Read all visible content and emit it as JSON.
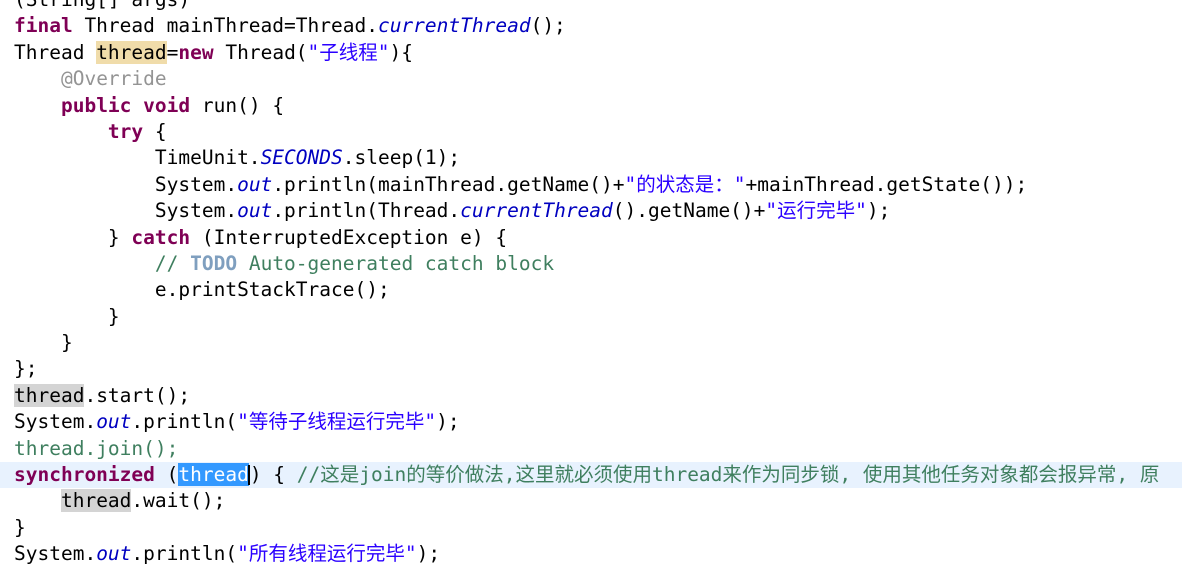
{
  "editor": {
    "language": "Java",
    "font_size_px": 19.5,
    "line_height_px": 26.4,
    "background": "#ffffff",
    "current_line_background": "#e8f2fe",
    "colors": {
      "keyword": "#7f0055",
      "string": "#2a00ff",
      "comment": "#3f7f5f",
      "todo_tag": "#7f9fbf",
      "annotation": "#949494",
      "static_field": "#0000c0",
      "plain_text": "#000000",
      "write_occurrence_highlight": "#f0dcaa",
      "read_occurrence_highlight": "#d4d4d4",
      "selection_background": "#3399ff",
      "selection_text": "#ffffff"
    }
  },
  "code": {
    "line_0": {
      "partial_clipped": "(String[] args)"
    },
    "line_1": {
      "kw_final": "final",
      "t_thread_type": " Thread mainThread=Thread.",
      "static_currentThread": "currentThread",
      "t_tail": "();"
    },
    "line_2": {
      "t_thread_type": "Thread ",
      "var_thread": "thread",
      "t_eq": "=",
      "kw_new": "new",
      "t_ctor": " Thread(",
      "str_child": "\"子线程\"",
      "t_tail": "){"
    },
    "line_3": {
      "annotation": "@Override"
    },
    "line_4": {
      "kw_public": "public",
      "sp1": " ",
      "kw_void": "void",
      "t_run": " run() {"
    },
    "line_5": {
      "kw_try": "try",
      "t_brace": " {"
    },
    "line_6": {
      "t_timeunit": "TimeUnit.",
      "static_seconds": "SECONDS",
      "t_sleep": ".sleep(1);"
    },
    "line_7": {
      "t_system": "System.",
      "static_out": "out",
      "t_mid": ".println(mainThread.getName()+",
      "str_state": "\"的状态是：\"",
      "t_tail": "+mainThread.getState());"
    },
    "line_8": {
      "t_system": "System.",
      "static_out": "out",
      "t_mid": ".println(Thread.",
      "static_currentThread": "currentThread",
      "t_mid2": "().getName()+",
      "str_done": "\"运行完毕\"",
      "t_tail": ");"
    },
    "line_9": {
      "t_close": "} ",
      "kw_catch": "catch",
      "t_tail": " (InterruptedException e) {"
    },
    "line_10": {
      "cmt_slashes": "// ",
      "todo": "TODO",
      "cmt_rest": " Auto-generated catch block"
    },
    "line_11": {
      "t": "e.printStackTrace();"
    },
    "line_12": {
      "t": "}"
    },
    "line_13": {
      "t": "}"
    },
    "line_14": {
      "t": "};"
    },
    "line_15": {
      "var_thread": "thread",
      "t_tail": ".start();"
    },
    "line_16": {
      "t_system": "System.",
      "static_out": "out",
      "t_mid": ".println(",
      "str_wait": "\"等待子线程运行完毕\"",
      "t_tail": ");"
    },
    "line_17": {
      "cmt_join": "thread.join();"
    },
    "line_18": {
      "kw_synchronized": "synchronized",
      "t_open": " (",
      "sel_thread": "thread",
      "t_close": ") { ",
      "cmt": "//这是join的等价做法,这里就必须使用thread来作为同步锁, 使用其他任务对象都会报异常, 原"
    },
    "line_19": {
      "var_thread": "thread",
      "t_tail": ".wait();"
    },
    "line_20": {
      "t": "}"
    },
    "line_21": {
      "t_system": "System.",
      "static_out": "out",
      "t_mid": ".println(",
      "str_all": "\"所有线程运行完毕\"",
      "t_tail": ");"
    }
  }
}
